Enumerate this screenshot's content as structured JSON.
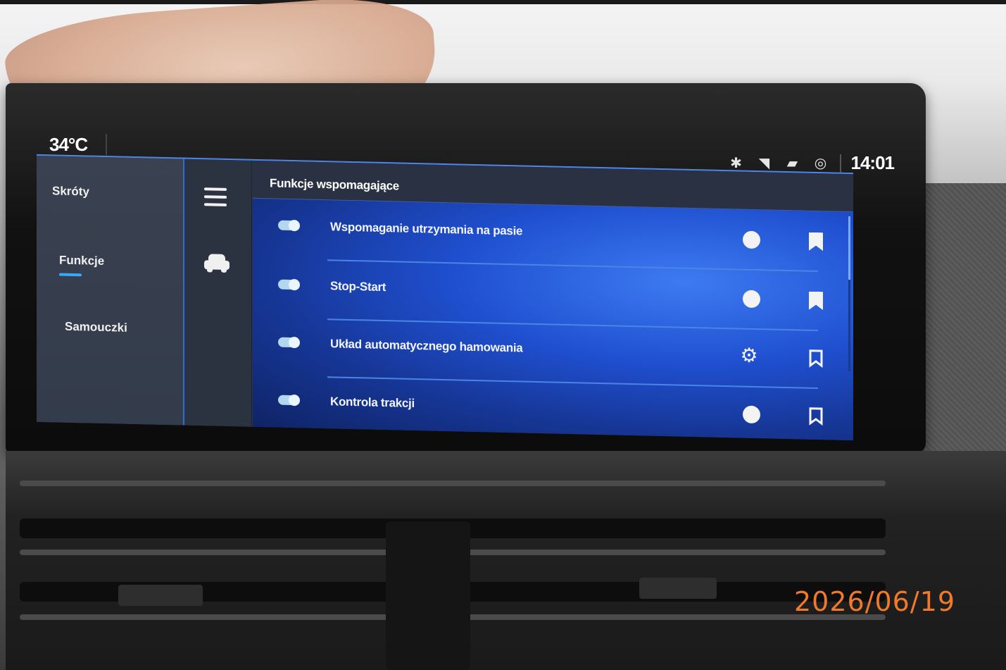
{
  "status_bar": {
    "temperature": "34°C",
    "time": "14:01",
    "icons": [
      "bluetooth-icon",
      "wifi-icon",
      "car-connect-icon",
      "location-icon"
    ]
  },
  "sidebar": {
    "items": [
      {
        "label": "Skróty"
      },
      {
        "label": "Funkcje",
        "selected": true
      },
      {
        "label": "Samouczki"
      }
    ]
  },
  "icon_rail": {
    "icons": [
      "menu-icon",
      "car-icon"
    ]
  },
  "content": {
    "title": "Funkcje wspomagające",
    "rows": [
      {
        "label": "Wspomaganie utrzymania na pasie",
        "toggle": true,
        "action_icon": "dot-icon",
        "bookmarked": true
      },
      {
        "label": "Stop-Start",
        "toggle": true,
        "action_icon": "dot-icon",
        "bookmarked": true
      },
      {
        "label": "Układ automatycznego hamowania",
        "toggle": true,
        "action_icon": "gear-icon",
        "bookmarked": false
      },
      {
        "label": "Kontrola trakcji",
        "toggle": true,
        "action_icon": "dot-icon",
        "bookmarked": false
      }
    ]
  },
  "photo": {
    "date_stamp": "2026/06/19",
    "stamp_color": "#f07a2a",
    "accent_color": "#2f6bd9"
  }
}
